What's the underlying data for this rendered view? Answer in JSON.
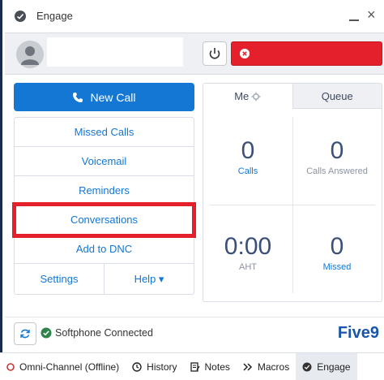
{
  "window": {
    "title": "Engage",
    "close_glyph": "×"
  },
  "new_call": {
    "label": "New Call"
  },
  "menu": {
    "items": [
      "Missed Calls",
      "Voicemail",
      "Reminders",
      "Conversations",
      "Add to DNC"
    ],
    "settings": "Settings",
    "help": "Help ▾"
  },
  "stats": {
    "tabs": [
      "Me",
      "Queue"
    ],
    "calls": {
      "value": "0",
      "label": "Calls"
    },
    "calls_answered": {
      "value": "0",
      "label": "Calls Answered"
    },
    "aht": {
      "value": "0:00",
      "label": "AHT"
    },
    "missed": {
      "value": "0",
      "label": "Missed"
    }
  },
  "footer": {
    "status": "Softphone Connected",
    "brand": "Five9"
  },
  "utility_bar": [
    {
      "label": "Omni-Channel (Offline)",
      "icon": "omni-channel-icon"
    },
    {
      "label": "History",
      "icon": "clock-icon"
    },
    {
      "label": "Notes",
      "icon": "notes-icon"
    },
    {
      "label": "Macros",
      "icon": "macros-icon"
    },
    {
      "label": "Engage",
      "icon": "engage-icon"
    }
  ],
  "colors": {
    "accent": "#1477d4",
    "status_red": "#e3202b",
    "number": "#3a4f7a"
  }
}
